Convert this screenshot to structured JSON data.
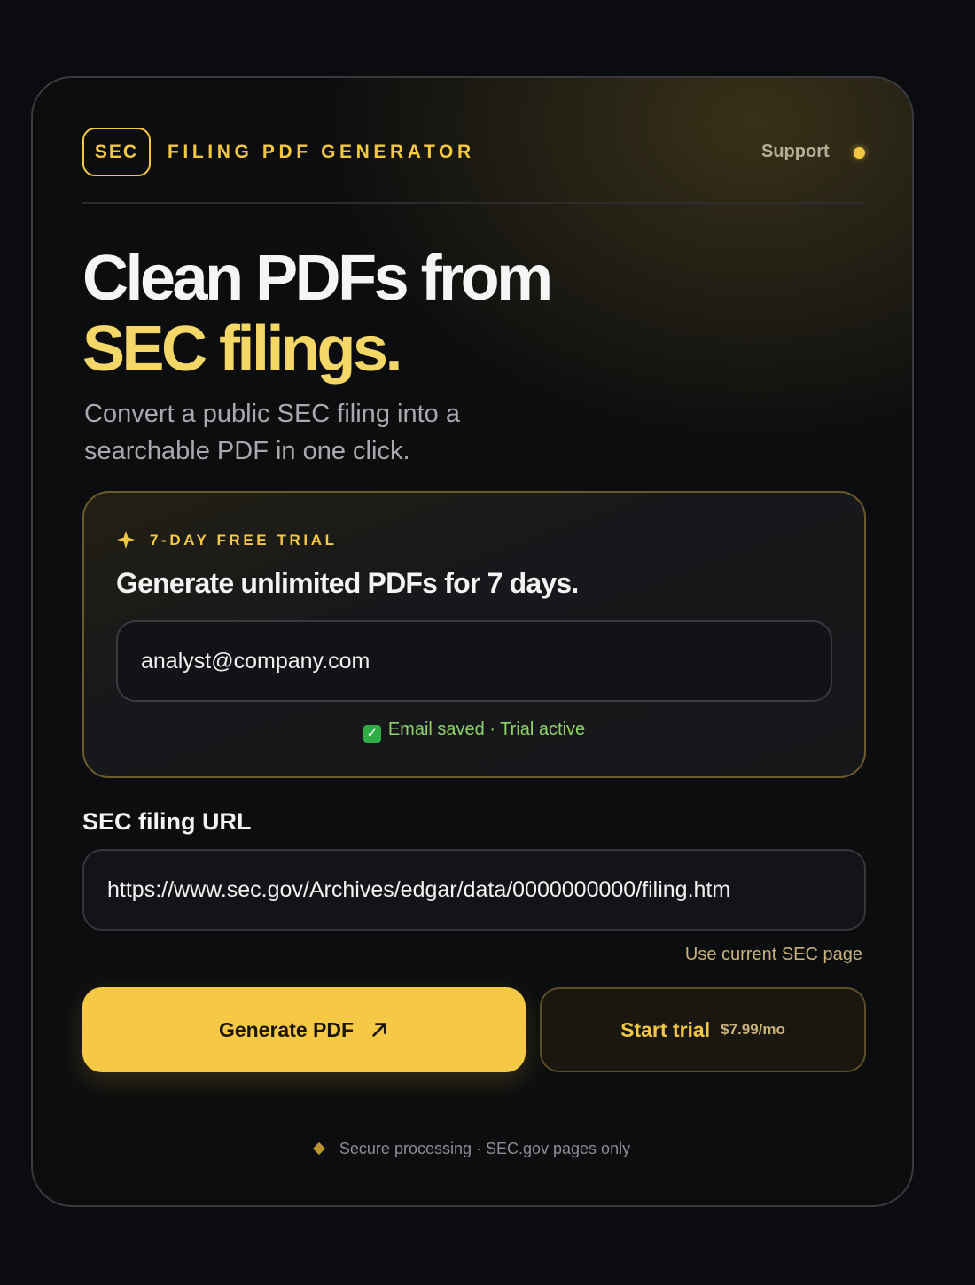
{
  "header": {
    "logo_text": "SEC",
    "title": "FILING PDF GENERATOR",
    "support_label": "Support",
    "status_color": "#f5c842"
  },
  "hero": {
    "headline_line1": "Clean PDFs from",
    "headline_line2": "SEC filings.",
    "subtitle": "Convert a public SEC filing into a searchable PDF in one click."
  },
  "trial": {
    "badge": "7-DAY FREE TRIAL",
    "badge_icon": "sparkle-icon",
    "heading": "Generate unlimited PDFs for 7 days.",
    "email_value": "analyst@company.com",
    "status_icon": "check-icon",
    "status_text": "Email saved · Trial active"
  },
  "url_form": {
    "label": "SEC filing URL",
    "value": "https://www.sec.gov/Archives/edgar/data/0000000000/filing.htm",
    "use_current_link": "Use current SEC page"
  },
  "actions": {
    "generate_label": "Generate PDF",
    "generate_icon": "arrow-up-right-icon",
    "trial_label": "Start trial",
    "trial_price": "$7.99/mo"
  },
  "footer": {
    "icon": "diamond-icon",
    "text": "Secure processing · SEC.gov pages only"
  },
  "colors": {
    "accent": "#f5c842",
    "background": "#0a0c0f",
    "success": "#8fd26a"
  }
}
